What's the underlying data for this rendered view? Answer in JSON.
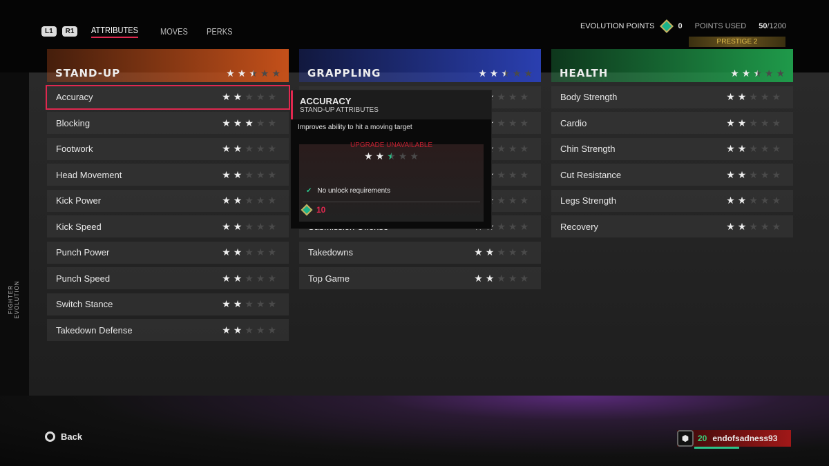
{
  "nav": {
    "l1": "L1",
    "r1": "R1",
    "tabs": [
      "ATTRIBUTES",
      "MOVES",
      "PERKS"
    ]
  },
  "side_label": "FIGHTER EVOLUTION",
  "points": {
    "evolution_label": "EVOLUTION POINTS",
    "evolution_value": "0",
    "used_label": "POINTS USED",
    "used_value": "50",
    "used_max": "/1200",
    "prestige": "PRESTIGE 2"
  },
  "columns": [
    {
      "title": "STAND-UP",
      "color": "#c4501a",
      "rating": 2.5,
      "rows": [
        {
          "name": "Accuracy",
          "stars": 2
        },
        {
          "name": "Blocking",
          "stars": 3
        },
        {
          "name": "Footwork",
          "stars": 2
        },
        {
          "name": "Head Movement",
          "stars": 2
        },
        {
          "name": "Kick Power",
          "stars": 2
        },
        {
          "name": "Kick Speed",
          "stars": 2
        },
        {
          "name": "Punch Power",
          "stars": 2
        },
        {
          "name": "Punch Speed",
          "stars": 2
        },
        {
          "name": "Switch Stance",
          "stars": 2
        },
        {
          "name": "Takedown Defense",
          "stars": 2
        }
      ]
    },
    {
      "title": "GRAPPLING",
      "color": "#2a3fb0",
      "rating": 2.5,
      "rows": [
        {
          "name": "",
          "stars": 2
        },
        {
          "name": "",
          "stars": 2
        },
        {
          "name": "",
          "stars": 2
        },
        {
          "name": "",
          "stars": 2
        },
        {
          "name": "",
          "stars": 2
        },
        {
          "name": "Submission Offense",
          "stars": 2
        },
        {
          "name": "Takedowns",
          "stars": 2
        },
        {
          "name": "Top Game",
          "stars": 2
        }
      ]
    },
    {
      "title": "HEALTH",
      "color": "#1f9a4a",
      "rating": 2.5,
      "rows": [
        {
          "name": "Body Strength",
          "stars": 2
        },
        {
          "name": "Cardio",
          "stars": 2
        },
        {
          "name": "Chin Strength",
          "stars": 2
        },
        {
          "name": "Cut Resistance",
          "stars": 2
        },
        {
          "name": "Legs Strength",
          "stars": 2
        },
        {
          "name": "Recovery",
          "stars": 2
        }
      ]
    }
  ],
  "tooltip": {
    "title": "ACCURACY",
    "subtitle": "STAND-UP ATTRIBUTES",
    "description": "Improves ability to hit a moving target",
    "status": "UPGRADE UNAVAILABLE",
    "rating": 2.5,
    "requirement": "No unlock requirements",
    "cost": "10"
  },
  "back": "Back",
  "player": {
    "level": "20",
    "name": "endofsadness93",
    "xp_progress": 0.5
  }
}
